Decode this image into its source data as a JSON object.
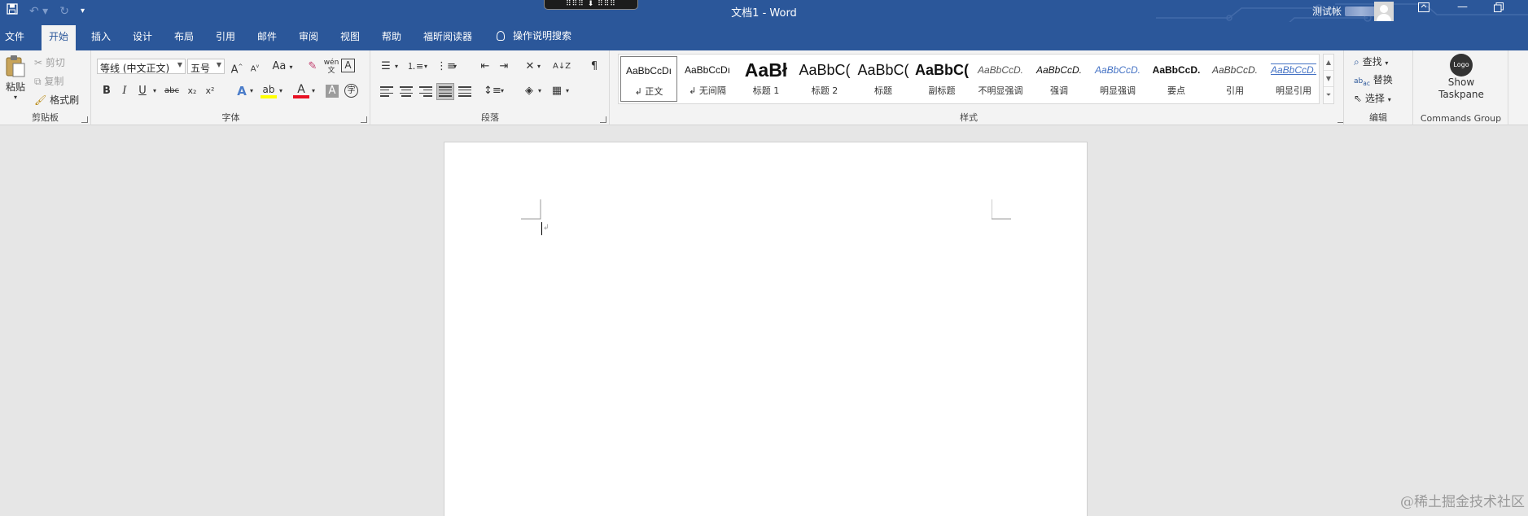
{
  "titlebar": {
    "title": "文档1  -  Word",
    "user_name": "测试帐",
    "drop_handle": "⠿⠿⠿ ⬇ ⠿⠿⠿",
    "qat": {
      "save_icon": "save-icon",
      "undo_icon": "undo-icon",
      "redo_icon": "redo-icon",
      "customize_icon": "customize-qat-icon"
    }
  },
  "tabs": [
    "文件",
    "开始",
    "插入",
    "设计",
    "布局",
    "引用",
    "邮件",
    "审阅",
    "视图",
    "帮助",
    "福昕阅读器"
  ],
  "active_tab": "开始",
  "tell_me": "操作说明搜索",
  "clipboard": {
    "label": "剪贴板",
    "paste": "粘贴",
    "cut": "剪切",
    "copy": "复制",
    "format_painter": "格式刷"
  },
  "font": {
    "label": "字体",
    "font_name": "等线 (中文正文)",
    "font_size": "五号",
    "grow": "A",
    "shrink": "A",
    "change_case": "Aa",
    "phonetic": "wén",
    "bold": "B",
    "italic": "I",
    "underline": "U",
    "strike": "abc",
    "subscript": "x₂",
    "superscript": "x²",
    "font_color": "A",
    "char_shading": "A",
    "enclose": "字"
  },
  "paragraph": {
    "label": "段落"
  },
  "styles": {
    "label": "样式",
    "items": [
      {
        "preview": "AaBbCcDı",
        "name": "↲ 正文"
      },
      {
        "preview": "AaBbCcDı",
        "name": "↲ 无间隔"
      },
      {
        "preview": "AaBł",
        "name": "标题 1"
      },
      {
        "preview": "AaBbC(",
        "name": "标题 2"
      },
      {
        "preview": "AaBbC(",
        "name": "标题"
      },
      {
        "preview": "AaBbC(",
        "name": "副标题"
      },
      {
        "preview": "AaBbCcD.",
        "name": "不明显强调"
      },
      {
        "preview": "AaBbCcD.",
        "name": "强调"
      },
      {
        "preview": "AaBbCcD.",
        "name": "明显强调"
      },
      {
        "preview": "AaBbCcD.",
        "name": "要点"
      },
      {
        "preview": "AaBbCcD.",
        "name": "引用"
      },
      {
        "preview": "AaBbCcD.",
        "name": "明显引用"
      }
    ]
  },
  "editing": {
    "label": "编辑",
    "find": "查找",
    "replace": "替换",
    "select": "选择"
  },
  "addin": {
    "logo": "Logo",
    "show": "Show",
    "taskpane": "Taskpane",
    "label": "Commands Group"
  },
  "watermark": "@稀土掘金技术社区",
  "colors": {
    "brand": "#2b579a",
    "ribbon": "#f3f3f3",
    "canvas": "#e6e6e6",
    "font_color_bar": "#e81123",
    "highlight_bar": "#ffff00"
  }
}
